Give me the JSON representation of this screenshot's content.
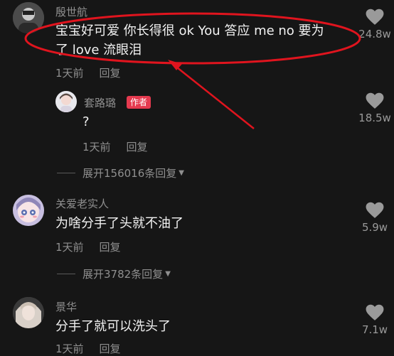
{
  "comments": [
    {
      "username": "殷世航",
      "text_line1": "宝宝好可爱 你长得很 ok You 答应 me no 要为",
      "text_line2": "了 love 流眼泪",
      "time": "1天前",
      "reply": "回复",
      "likes": "24.8w"
    },
    {
      "username": "套路璐",
      "badge": "作者",
      "text": "?",
      "time": "1天前",
      "reply": "回复",
      "likes": "18.5w",
      "expand": "展开156016条回复"
    },
    {
      "username": "关爱老实人",
      "text": "为啥分手了头就不油了",
      "time": "1天前",
      "reply": "回复",
      "likes": "5.9w",
      "expand": "展开3782条回复"
    },
    {
      "username": "景华",
      "text": "分手了就可以洗头了",
      "time": "1天前",
      "reply": "回复",
      "likes": "7.1w"
    }
  ],
  "colors": {
    "background": "#161616",
    "annotation": "#e0141e",
    "badge": "#e53a4f",
    "secondary_text": "#8f8f8f"
  },
  "icons": [
    "heart-icon",
    "chevron-down-icon"
  ]
}
